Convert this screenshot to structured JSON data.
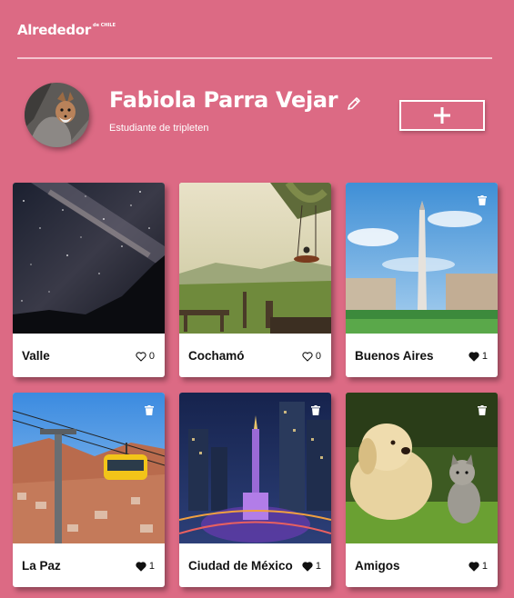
{
  "header": {
    "logo": "Alrededor",
    "logo_sup": "de CHILE"
  },
  "profile": {
    "name": "Fabiola Parra Vejar",
    "bio": "Estudiante de tripleten"
  },
  "colors": {
    "background": "#dc6a84",
    "card": "#ffffff"
  },
  "cards": [
    {
      "title": "Valle",
      "likes": "0",
      "liked": false,
      "deletable": false
    },
    {
      "title": "Cochamó",
      "likes": "0",
      "liked": false,
      "deletable": false
    },
    {
      "title": "Buenos Aires",
      "likes": "1",
      "liked": true,
      "deletable": true
    },
    {
      "title": "La Paz",
      "likes": "1",
      "liked": true,
      "deletable": true
    },
    {
      "title": "Ciudad de México",
      "likes": "1",
      "liked": true,
      "deletable": true
    },
    {
      "title": "Amigos",
      "likes": "1",
      "liked": true,
      "deletable": true
    }
  ]
}
